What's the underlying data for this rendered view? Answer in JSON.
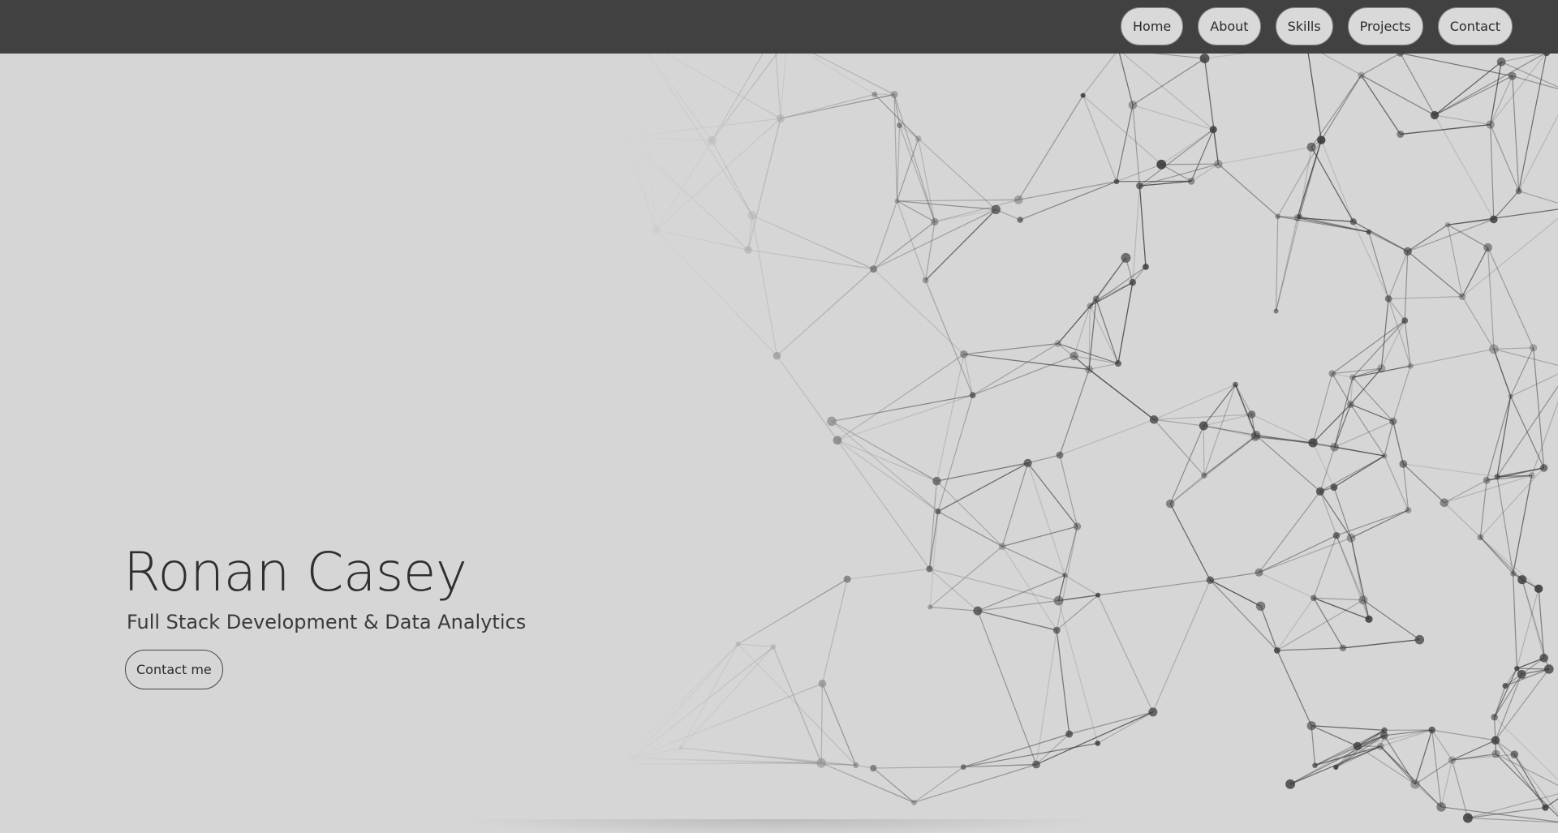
{
  "nav": {
    "items": [
      {
        "label": "Home"
      },
      {
        "label": "About"
      },
      {
        "label": "Skills"
      },
      {
        "label": "Projects"
      },
      {
        "label": "Contact"
      }
    ]
  },
  "hero": {
    "title": "Ronan Casey",
    "subtitle": "Full Stack Development & Data Analytics",
    "cta_label": "Contact me"
  },
  "colors": {
    "navbar": "#414141",
    "background": "#d6d6d6",
    "text": "#2f2f2f",
    "network_lines": "#3a3a3a"
  },
  "background_graphic": "network-graph"
}
